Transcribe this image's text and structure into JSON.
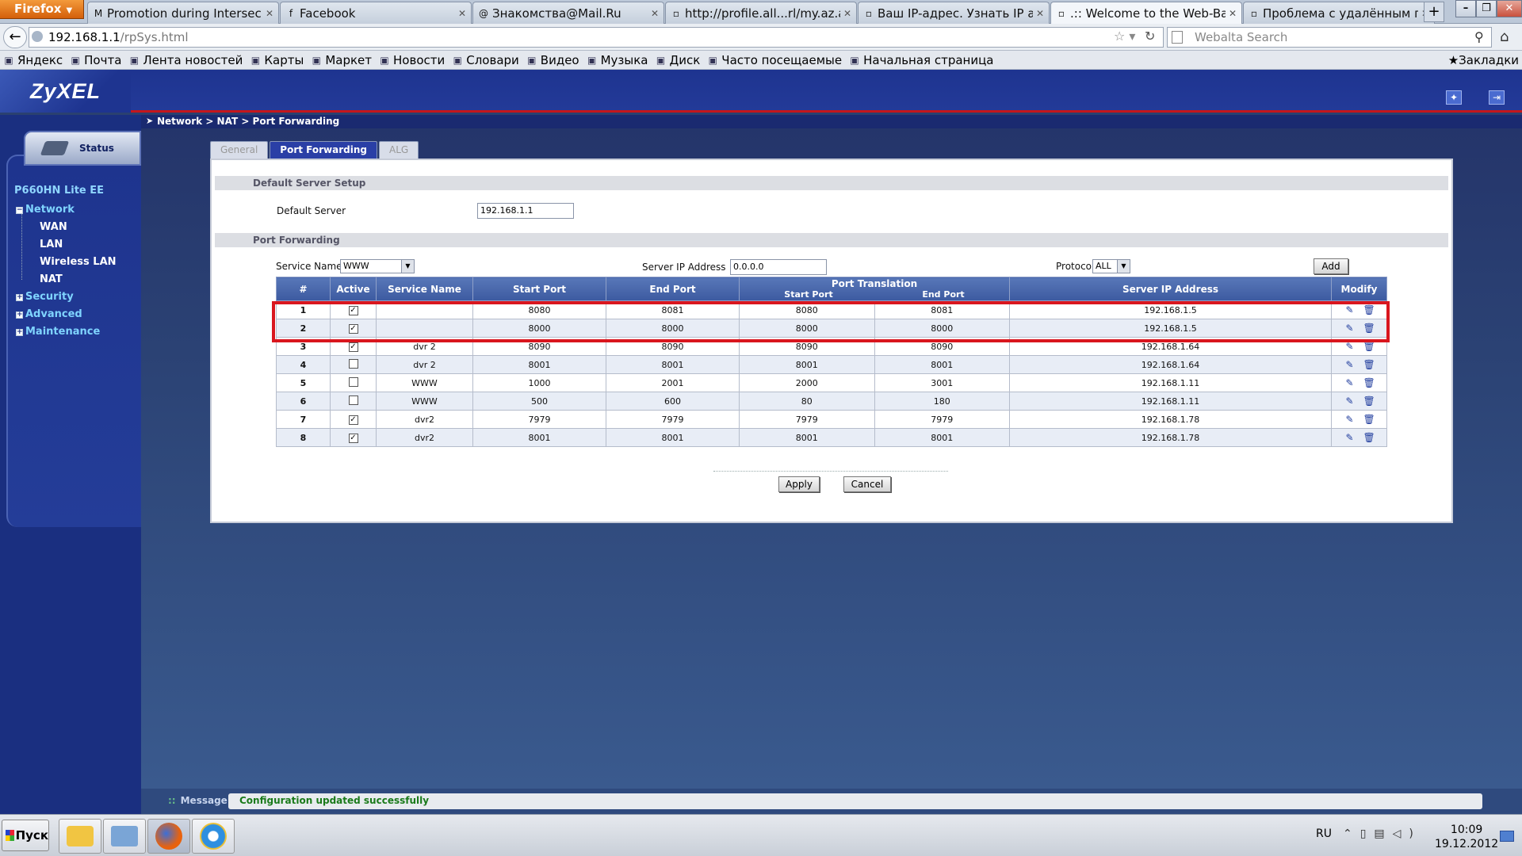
{
  "browser": {
    "app_button": "Firefox",
    "tabs": [
      {
        "title": "Promotion during Intersec Du...",
        "icon": "gmail-icon"
      },
      {
        "title": "Facebook",
        "icon": "facebook-icon"
      },
      {
        "title": "Знакомства@Mail.Ru",
        "icon": "mailru-icon"
      },
      {
        "title": "http://profile.all...rl/my.az.all.biz/",
        "icon": "page-icon"
      },
      {
        "title": "Ваш IP-адрес. Узнать IP адре...",
        "icon": "page-icon"
      },
      {
        "title": ".:: Welcome to the Web-Base...",
        "icon": "page-icon"
      },
      {
        "title": "Проблема с удалённым подкл...",
        "icon": "page-icon"
      }
    ],
    "active_tab": 5,
    "url_host": "192.168.1.1",
    "url_path": "/rpSys.html",
    "search_placeholder": "Webalta Search",
    "bookmarks": [
      "Яндекс",
      "Почта",
      "Лента новостей",
      "Карты",
      "Маркет",
      "Новости",
      "Словари",
      "Видео",
      "Музыка",
      "Диск",
      "Часто посещаемые",
      "Начальная страница"
    ],
    "bookmarks_menu": "Закладки"
  },
  "router": {
    "logo": "ZyXEL",
    "breadcrumb": "Network > NAT > Port Forwarding",
    "sidebar": {
      "status_label": "Status",
      "model": "P660HN Lite EE",
      "network": "Network",
      "network_children": [
        "WAN",
        "LAN",
        "Wireless LAN",
        "NAT"
      ],
      "security": "Security",
      "advanced": "Advanced",
      "maintenance": "Maintenance"
    },
    "tabs": [
      "General",
      "Port Forwarding",
      "ALG"
    ],
    "active_tab": "Port Forwarding",
    "default_server_section": "Default Server Setup",
    "default_server_label": "Default Server",
    "default_server_value": "192.168.1.1",
    "pf_section": "Port Forwarding",
    "service_name_label": "Service Name",
    "service_name_value": "WWW",
    "server_ip_label": "Server IP Address",
    "server_ip_value": "0.0.0.0",
    "protocol_label": "Protocol",
    "protocol_value": "ALL",
    "add_button": "Add",
    "table": {
      "headers": {
        "num": "#",
        "active": "Active",
        "service": "Service Name",
        "start": "Start Port",
        "end": "End Port",
        "translation": "Port Translation",
        "tr_start": "Start Port",
        "tr_end": "End Port",
        "server_ip": "Server IP Address",
        "modify": "Modify"
      },
      "rows": [
        {
          "num": "1",
          "active": true,
          "service": "",
          "start": "8080",
          "end": "8081",
          "tr_start": "8080",
          "tr_end": "8081",
          "ip": "192.168.1.5"
        },
        {
          "num": "2",
          "active": true,
          "service": "",
          "start": "8000",
          "end": "8000",
          "tr_start": "8000",
          "tr_end": "8000",
          "ip": "192.168.1.5"
        },
        {
          "num": "3",
          "active": true,
          "service": "dvr 2",
          "start": "8090",
          "end": "8090",
          "tr_start": "8090",
          "tr_end": "8090",
          "ip": "192.168.1.64"
        },
        {
          "num": "4",
          "active": false,
          "service": "dvr 2",
          "start": "8001",
          "end": "8001",
          "tr_start": "8001",
          "tr_end": "8001",
          "ip": "192.168.1.64"
        },
        {
          "num": "5",
          "active": false,
          "service": "WWW",
          "start": "1000",
          "end": "2001",
          "tr_start": "2000",
          "tr_end": "3001",
          "ip": "192.168.1.11"
        },
        {
          "num": "6",
          "active": false,
          "service": "WWW",
          "start": "500",
          "end": "600",
          "tr_start": "80",
          "tr_end": "180",
          "ip": "192.168.1.11"
        },
        {
          "num": "7",
          "active": true,
          "service": "dvr2",
          "start": "7979",
          "end": "7979",
          "tr_start": "7979",
          "tr_end": "7979",
          "ip": "192.168.1.78"
        },
        {
          "num": "8",
          "active": true,
          "service": "dvr2",
          "start": "8001",
          "end": "8001",
          "tr_start": "8001",
          "tr_end": "8001",
          "ip": "192.168.1.78"
        }
      ]
    },
    "apply_button": "Apply",
    "cancel_button": "Cancel",
    "message_label": "Message",
    "message_text": "Configuration updated successfully"
  },
  "taskbar": {
    "start_label": "Пуск",
    "apps": [
      "explorer-icon",
      "control-panel-icon",
      "firefox-icon",
      "ie-icon"
    ],
    "language": "RU",
    "time": "10:09",
    "date": "19.12.2012"
  },
  "colors": {
    "zyxel_blue": "#1e3490",
    "highlight_red": "#d9161e",
    "message_green": "#1a7a1a"
  }
}
